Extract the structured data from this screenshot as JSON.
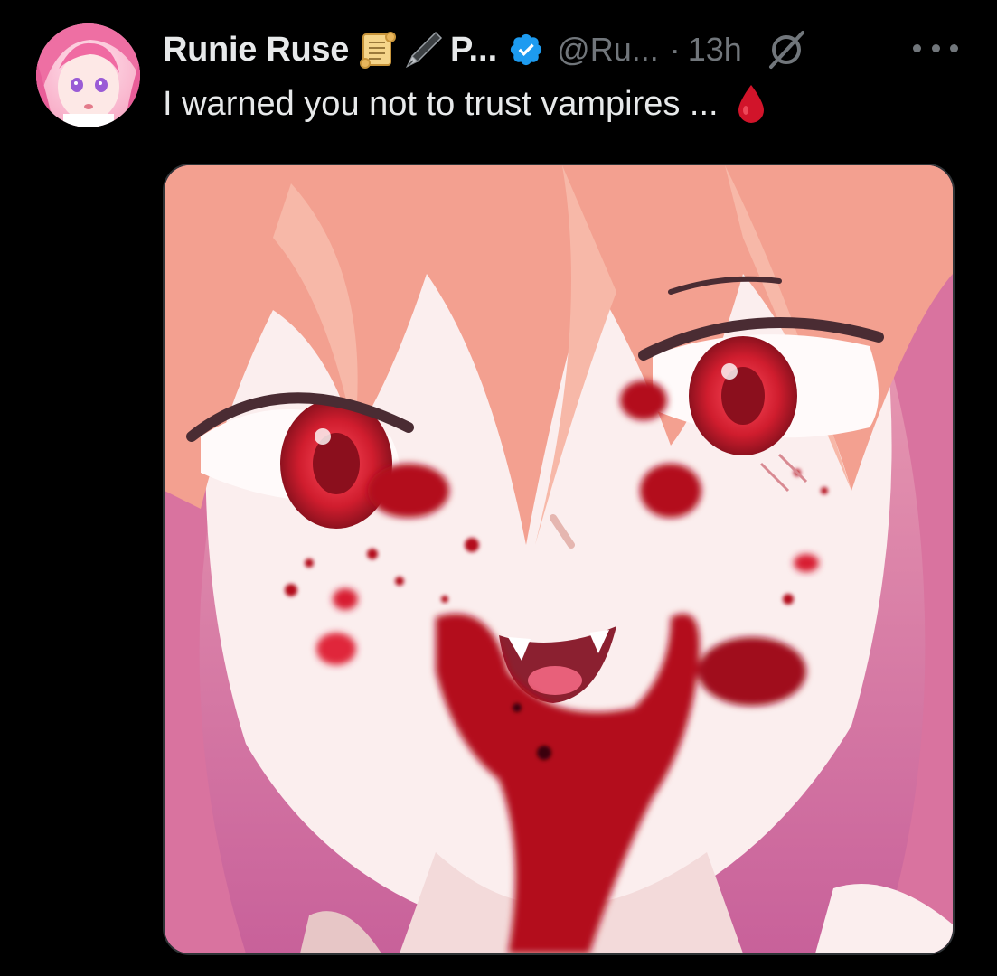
{
  "post": {
    "author": {
      "display_name": "Runie Ruse",
      "display_name_truncated": "P...",
      "handle": "@Ru...",
      "name_emojis": [
        "scroll-icon",
        "fountain-pen-icon"
      ],
      "verified": true
    },
    "separator": "·",
    "timestamp": "13h",
    "text": "I warned you not to trust vampires ...",
    "text_emoji": "blood-drop-icon",
    "media": {
      "type": "image",
      "description_icon": "anime-vampire-girl-illustration"
    }
  },
  "colors": {
    "background": "#000000",
    "primary_text": "#e7e9ea",
    "secondary_text": "#71767b",
    "verified_blue": "#1d9bf0",
    "blood_red": "#c1121f"
  }
}
